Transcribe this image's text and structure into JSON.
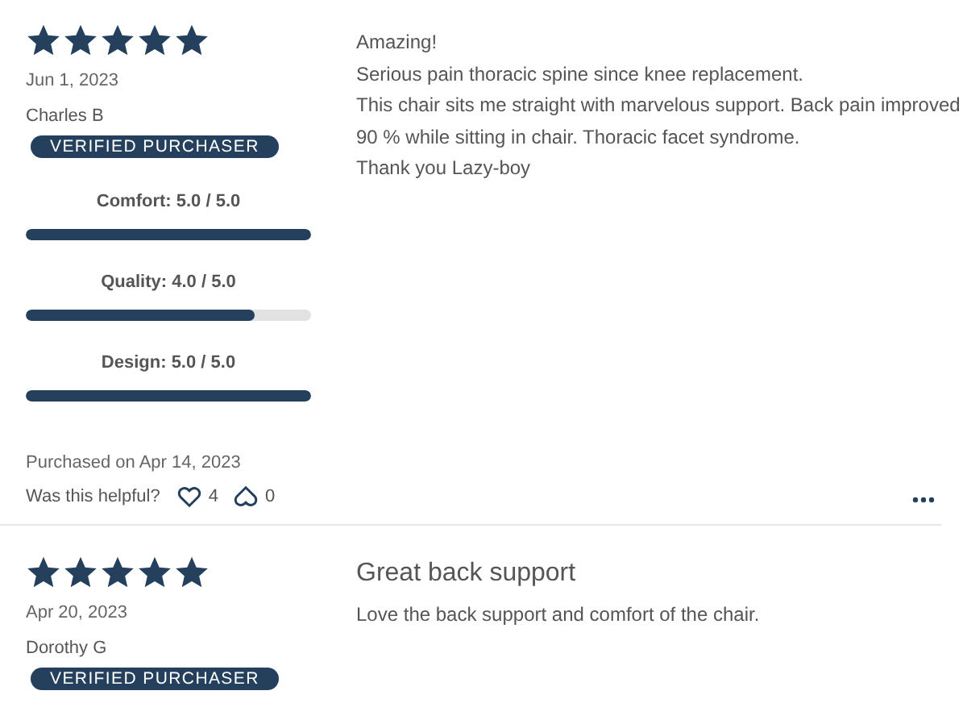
{
  "reviews": [
    {
      "stars": 5,
      "date": "Jun 1, 2023",
      "author": "Charles B",
      "badge": "VERIFIED PURCHASER",
      "ratings": [
        {
          "label": "Comfort: 5.0 / 5.0",
          "level": 1.0
        },
        {
          "label": "Quality: 4.0 / 5.0",
          "level": 0.8
        },
        {
          "label": "Design: 5.0 / 5.0",
          "level": 1.0
        }
      ],
      "body_lines": [
        "Amazing!",
        "Serious pain thoracic spine since knee replacement.",
        "This chair sits me straight with marvelous support. Back pain improved",
        "90 % while sitting in chair. Thoracic facet syndrome.",
        "Thank you Lazy-boy"
      ],
      "purchased": "Purchased on Apr 14, 2023",
      "helpful_label": "Was this helpful?",
      "likes": "4",
      "dislikes": "0"
    },
    {
      "stars": 5,
      "date": "Apr 20, 2023",
      "author": "Dorothy G",
      "badge": "VERIFIED PURCHASER",
      "title": "Great back support",
      "body_lines": [
        "Love the back support and comfort of the chair."
      ]
    }
  ]
}
